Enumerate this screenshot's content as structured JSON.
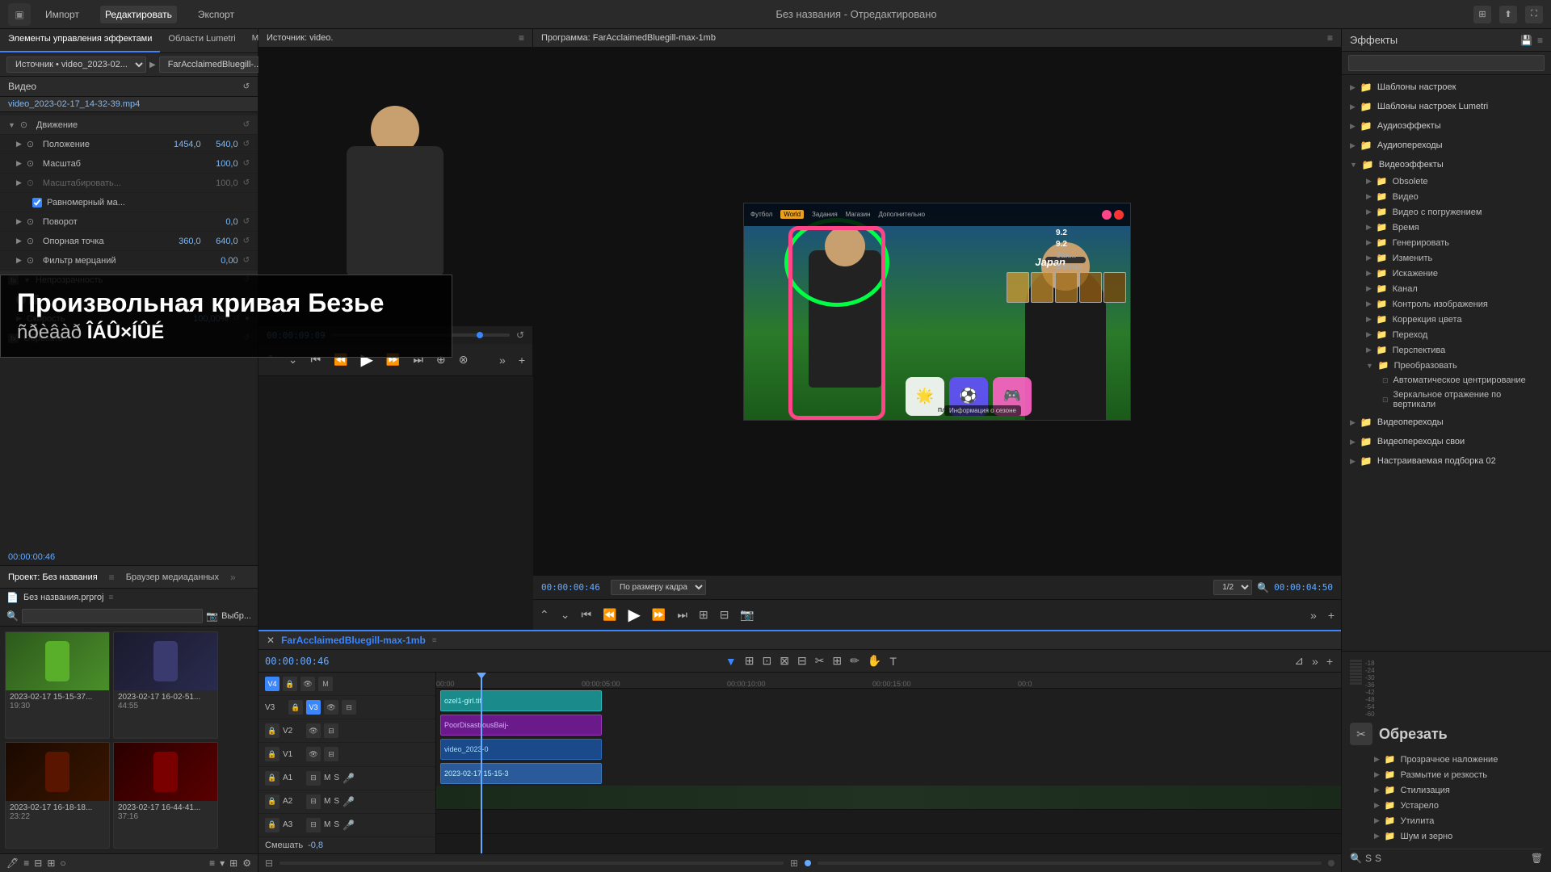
{
  "app": {
    "title": "Без названия - Отредактировано"
  },
  "topbar": {
    "logo": "⬛",
    "menu": [
      "Импорт",
      "Редактировать",
      "Экспорт"
    ],
    "active_menu": "Редактировать",
    "icons": [
      "⊞",
      "⬆",
      "⛶"
    ]
  },
  "left_panel": {
    "tabs": [
      "Элементы управления эффектами",
      "Области Lumetri",
      "Микш. аудиоклипа: FarAcclaimedBlu.."
    ],
    "source_label": "Источник • video_2023-02...",
    "source_value": "FarAcclaimedBluegill-..",
    "timecode": "00:00",
    "video_section": "Видео",
    "source_file": "video_2023-02-17_14-32-39.mp4",
    "properties": {
      "motion": {
        "label": "Движение",
        "position": {
          "name": "Положение",
          "x": "1454,0",
          "y": "540,0"
        },
        "scale": {
          "name": "Масштаб",
          "value": "100,0"
        },
        "scale_width": {
          "name": "Масштабировать...",
          "value": "100,0"
        },
        "uniform_scale": {
          "name": "Равномерный ма...",
          "checked": true
        },
        "rotation": {
          "name": "Поворот",
          "value": "0,0"
        },
        "anchor": {
          "name": "Опорная точка",
          "x": "360,0",
          "y": "640,0"
        },
        "flicker": {
          "name": "Фильтр мерцаний",
          "value": "0,00"
        }
      },
      "opacity": {
        "label": "Непрозрачность"
      }
    },
    "speed_label": "Скорость",
    "speed_value": "100,00%",
    "crop_label": "Обрезать",
    "time_position": "00:00:00:46",
    "blend_label": "Смешать",
    "blend_value": "-0,8"
  },
  "bezier": {
    "title": "Произвольная кривая Безье",
    "subtitle": "Ñðèâàð ÎÁÛ×ÍÛÉ"
  },
  "project_panel": {
    "tabs": [
      "Проект: Без названия",
      "Браузер медиаданных"
    ],
    "project_name": "Без названия.prproj",
    "search_placeholder": "🔍",
    "items": [
      {
        "name": "2023-02-17 15-15-37...",
        "duration": "19:30",
        "thumb_type": "green"
      },
      {
        "name": "2023-02-17 16-02-51...",
        "duration": "44:55",
        "thumb_type": "dark"
      },
      {
        "name": "2023-02-17 16-18-18...",
        "duration": "23:22",
        "thumb_type": "warcraft"
      },
      {
        "name": "2023-02-17 16-44-41...",
        "duration": "37:16",
        "thumb_type": "diablo"
      }
    ]
  },
  "source_monitor": {
    "title": "Источник: video.",
    "timecode": "00:00:09:09"
  },
  "program_monitor": {
    "title": "Программа: FarAcclaimedBluegill-max-1mb",
    "timecode": "00:00:00:46",
    "fit_label": "По размеру кадра",
    "fraction": "1/2",
    "duration": "00:00:04:50",
    "nav": [
      "Футбол",
      "World",
      "Задания",
      "Магазин",
      "Дополнительно"
    ],
    "japan_text": "Japan",
    "info_badge": "Информация о сезоне",
    "plan_igri": "План игры"
  },
  "timeline": {
    "name": "FarAcclaimedBluegill-max-1mb",
    "timecode": "00:00:00:46",
    "ruler": [
      "00:00",
      "00:00:05:00",
      "00:00:10:00",
      "00:00:15:00",
      "00:0"
    ],
    "tracks": {
      "v4": {
        "name": "V4",
        "clip": "ozel1-girl.tif"
      },
      "v3": {
        "name": "V3",
        "clip": "PoorDisastrousBaij-"
      },
      "v2": {
        "name": "V2",
        "clip": "video_2023-0"
      },
      "v1": {
        "name": "V1",
        "clip": "2023-02-17 15-15-3"
      },
      "a1": {
        "name": "A1"
      },
      "a2": {
        "name": "A2"
      },
      "a3": {
        "name": "A3"
      }
    },
    "blend_label": "Смешать",
    "blend_value": "-0,8"
  },
  "effects_panel": {
    "title": "Эффекты",
    "search_placeholder": "",
    "categories": [
      {
        "name": "Шаблоны настроек",
        "type": "folder",
        "expanded": false
      },
      {
        "name": "Шаблоны настроек Lumetri",
        "type": "folder",
        "expanded": false
      },
      {
        "name": "Аудиоэффекты",
        "type": "folder",
        "expanded": false
      },
      {
        "name": "Аудиопереходы",
        "type": "folder",
        "expanded": false
      },
      {
        "name": "Видеоэффекты",
        "type": "folder",
        "expanded": true,
        "children": [
          {
            "name": "Obsolete",
            "type": "folder"
          },
          {
            "name": "Видео",
            "type": "folder"
          },
          {
            "name": "Видео с погружением",
            "type": "folder"
          },
          {
            "name": "Время",
            "type": "folder"
          },
          {
            "name": "Генерировать",
            "type": "folder"
          },
          {
            "name": "Изменить",
            "type": "folder"
          },
          {
            "name": "Искажение",
            "type": "folder"
          },
          {
            "name": "Канал",
            "type": "folder"
          },
          {
            "name": "Контроль изображения",
            "type": "folder"
          },
          {
            "name": "Коррекция цвета",
            "type": "folder"
          },
          {
            "name": "Переход",
            "type": "folder"
          },
          {
            "name": "Перспектива",
            "type": "folder"
          },
          {
            "name": "Преобразовать",
            "type": "folder",
            "expanded": true,
            "children": [
              {
                "name": "Автоматическое центрирование",
                "type": "effect"
              },
              {
                "name": "Зеркальное отражение по вертикали",
                "type": "effect"
              }
            ]
          }
        ]
      },
      {
        "name": "Видеопереходы",
        "type": "folder",
        "expanded": false
      },
      {
        "name": "Видеопереходы свои",
        "type": "folder",
        "expanded": false
      },
      {
        "name": "Настраиваемая подборка 02",
        "type": "folder",
        "expanded": false
      }
    ],
    "crop": {
      "title": "Обрезать",
      "items": [
        {
          "name": "Прозрачное наложение",
          "type": "folder"
        },
        {
          "name": "Размытие и резкость",
          "type": "folder"
        },
        {
          "name": "Стилизация",
          "type": "folder"
        },
        {
          "name": "Устарело",
          "type": "folder"
        },
        {
          "name": "Утилита",
          "type": "folder"
        },
        {
          "name": "Шум и зерно",
          "type": "folder"
        }
      ]
    }
  }
}
